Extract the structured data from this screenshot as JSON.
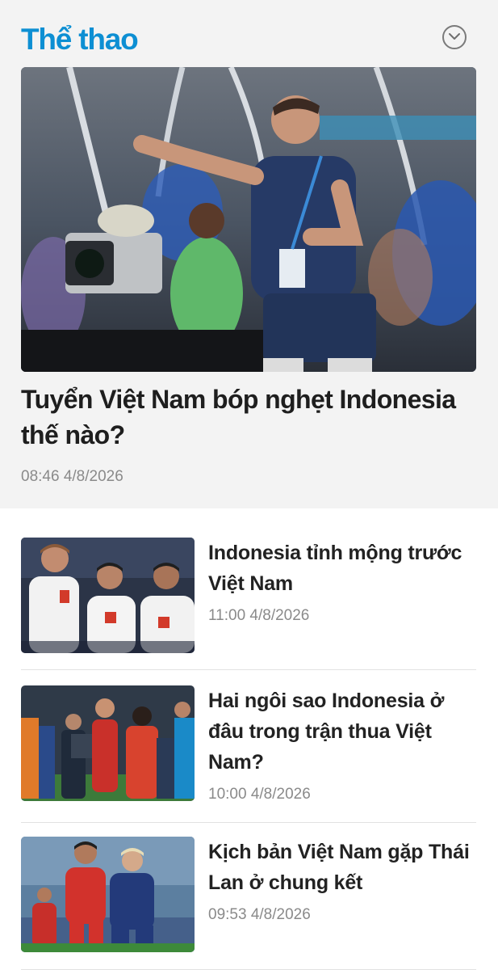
{
  "section": {
    "title": "Thể thao",
    "expand_icon": "chevron-down-circle-icon",
    "accent_color": "#0d8fd3"
  },
  "featured": {
    "title": "Tuyển Việt Nam bóp nghẹt Indonesia thế nào?",
    "time": "08:46 4/8/2026",
    "image": "coach-gesturing-sideline-photo"
  },
  "articles": [
    {
      "title": "Indonesia tỉnh mộng trước Việt Nam",
      "time": "11:00 4/8/2026",
      "image": "vietnam-players-celebrating-photo"
    },
    {
      "title": "Hai ngôi sao Indonesia ở đâu trong trận thua Việt Nam?",
      "time": "10:00 4/8/2026",
      "image": "players-and-photographers-photo"
    },
    {
      "title": "Kịch bản Việt Nam gặp Thái Lan ở chung kết",
      "time": "09:53 4/8/2026",
      "image": "vietnam-vs-thailand-duel-photo"
    }
  ]
}
